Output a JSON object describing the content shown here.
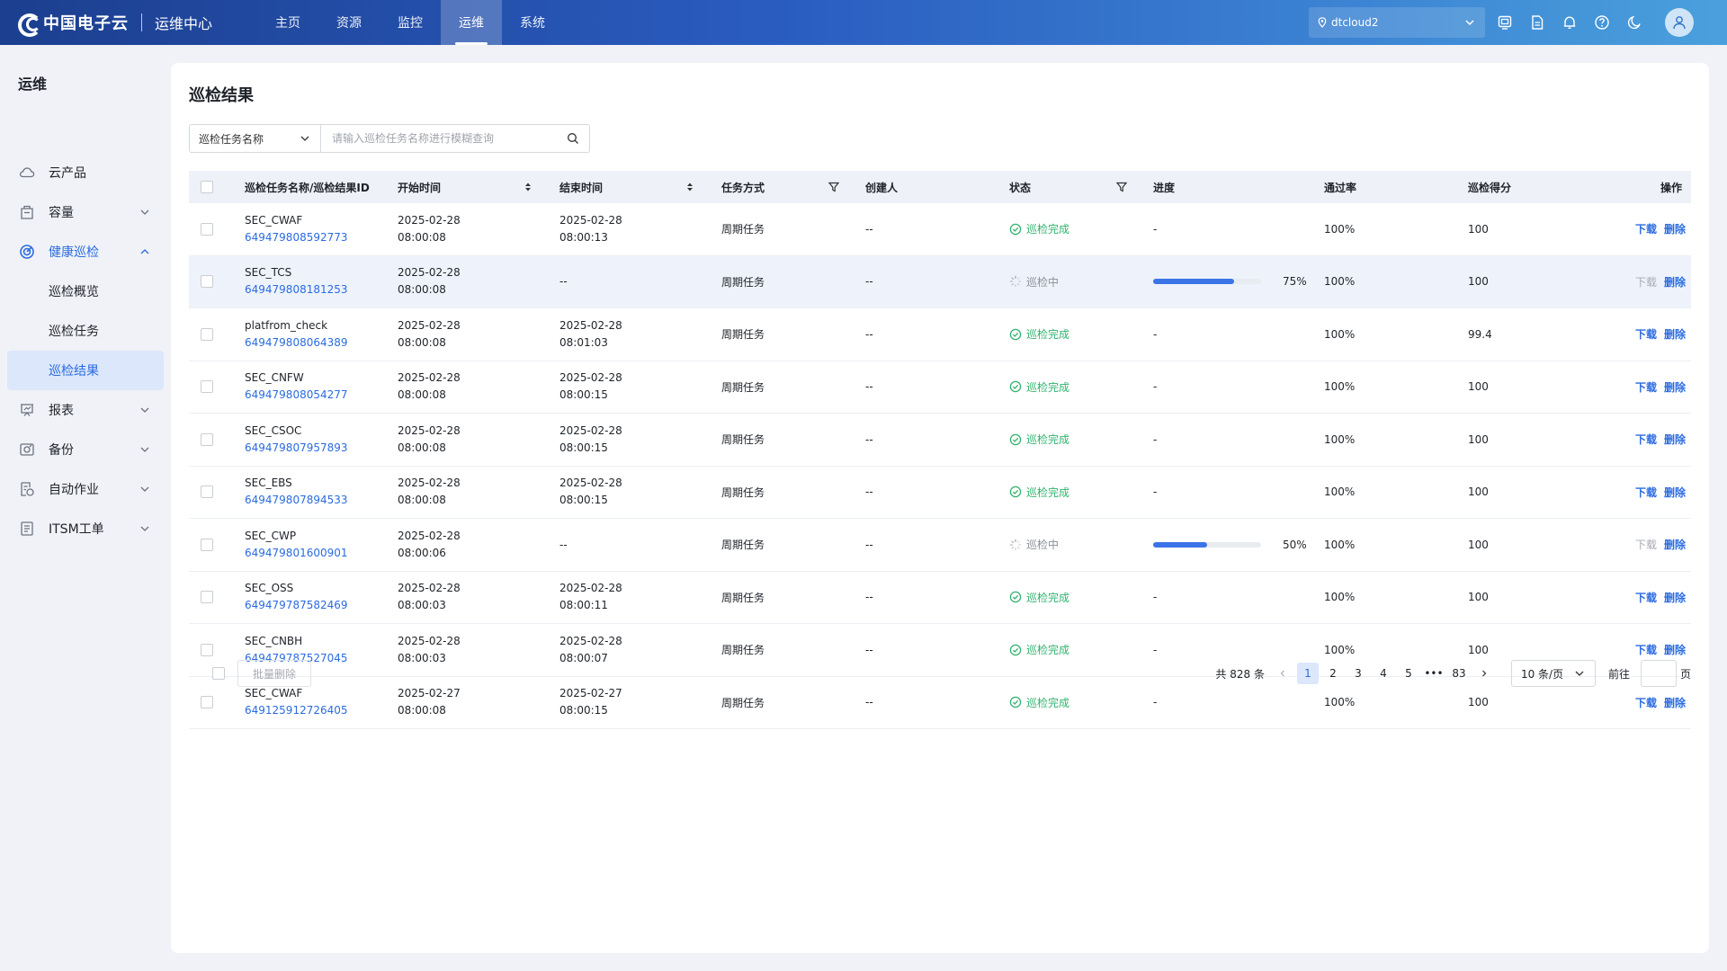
{
  "brand": {
    "logo_text": "中国电子云",
    "subtitle": "运维中心"
  },
  "topnav": [
    {
      "label": "主页",
      "active": false
    },
    {
      "label": "资源",
      "active": false
    },
    {
      "label": "监控",
      "active": false
    },
    {
      "label": "运维",
      "active": true
    },
    {
      "label": "系统",
      "active": false
    }
  ],
  "region": {
    "value": "dtcloud2"
  },
  "top_icons": [
    "screen-icon",
    "document-icon",
    "bell-icon",
    "help-icon",
    "moon-icon"
  ],
  "sidebar": {
    "title": "运维",
    "items": [
      {
        "label": "云产品",
        "icon": "cloud-icon"
      },
      {
        "label": "容量",
        "icon": "capacity-icon"
      },
      {
        "label": "健康巡检",
        "icon": "health-icon",
        "open": true,
        "children": [
          {
            "label": "巡检概览"
          },
          {
            "label": "巡检任务"
          },
          {
            "label": "巡检结果",
            "active": true
          }
        ]
      },
      {
        "label": "报表",
        "icon": "report-icon"
      },
      {
        "label": "备份",
        "icon": "backup-icon"
      },
      {
        "label": "自动作业",
        "icon": "automation-icon"
      },
      {
        "label": "ITSM工单",
        "icon": "ticket-icon"
      }
    ]
  },
  "page": {
    "title": "巡检结果"
  },
  "search": {
    "field": "巡检任务名称",
    "placeholder": "请输入巡检任务名称进行模糊查询"
  },
  "table": {
    "headers": {
      "name": "巡检任务名称/巡检结果ID",
      "start": "开始时间",
      "end": "结束时间",
      "mode": "任务方式",
      "creator": "创建人",
      "status": "状态",
      "progress": "进度",
      "rate": "通过率",
      "score": "巡检得分",
      "ops": "操作"
    },
    "rows": [
      {
        "name": "SEC_CWAF",
        "id": "649479808592773",
        "start_date": "2025-02-28",
        "start_time": "08:00:08",
        "end_date": "2025-02-28",
        "end_time": "08:00:13",
        "mode": "周期任务",
        "creator": "--",
        "status": "巡检完成",
        "status_type": "done",
        "progress": "-",
        "progress_pct": null,
        "rate": "100%",
        "score": "100",
        "download": "下载",
        "download_enabled": true,
        "delete": "删除"
      },
      {
        "name": "SEC_TCS",
        "id": "649479808181253",
        "start_date": "2025-02-28",
        "start_time": "08:00:08",
        "end_date": "--",
        "end_time": "",
        "mode": "周期任务",
        "creator": "--",
        "status": "巡检中",
        "status_type": "running",
        "progress": "75%",
        "progress_pct": 75,
        "rate": "100%",
        "score": "100",
        "download": "下载",
        "download_enabled": false,
        "delete": "删除"
      },
      {
        "name": "platfrom_check",
        "id": "649479808064389",
        "start_date": "2025-02-28",
        "start_time": "08:00:08",
        "end_date": "2025-02-28",
        "end_time": "08:01:03",
        "mode": "周期任务",
        "creator": "--",
        "status": "巡检完成",
        "status_type": "done",
        "progress": "-",
        "progress_pct": null,
        "rate": "100%",
        "score": "99.4",
        "download": "下载",
        "download_enabled": true,
        "delete": "删除"
      },
      {
        "name": "SEC_CNFW",
        "id": "649479808054277",
        "start_date": "2025-02-28",
        "start_time": "08:00:08",
        "end_date": "2025-02-28",
        "end_time": "08:00:15",
        "mode": "周期任务",
        "creator": "--",
        "status": "巡检完成",
        "status_type": "done",
        "progress": "-",
        "progress_pct": null,
        "rate": "100%",
        "score": "100",
        "download": "下载",
        "download_enabled": true,
        "delete": "删除"
      },
      {
        "name": "SEC_CSOC",
        "id": "649479807957893",
        "start_date": "2025-02-28",
        "start_time": "08:00:08",
        "end_date": "2025-02-28",
        "end_time": "08:00:15",
        "mode": "周期任务",
        "creator": "--",
        "status": "巡检完成",
        "status_type": "done",
        "progress": "-",
        "progress_pct": null,
        "rate": "100%",
        "score": "100",
        "download": "下载",
        "download_enabled": true,
        "delete": "删除"
      },
      {
        "name": "SEC_EBS",
        "id": "649479807894533",
        "start_date": "2025-02-28",
        "start_time": "08:00:08",
        "end_date": "2025-02-28",
        "end_time": "08:00:15",
        "mode": "周期任务",
        "creator": "--",
        "status": "巡检完成",
        "status_type": "done",
        "progress": "-",
        "progress_pct": null,
        "rate": "100%",
        "score": "100",
        "download": "下载",
        "download_enabled": true,
        "delete": "删除"
      },
      {
        "name": "SEC_CWP",
        "id": "649479801600901",
        "start_date": "2025-02-28",
        "start_time": "08:00:06",
        "end_date": "--",
        "end_time": "",
        "mode": "周期任务",
        "creator": "--",
        "status": "巡检中",
        "status_type": "running",
        "progress": "50%",
        "progress_pct": 50,
        "rate": "100%",
        "score": "100",
        "download": "下载",
        "download_enabled": false,
        "delete": "删除"
      },
      {
        "name": "SEC_OSS",
        "id": "649479787582469",
        "start_date": "2025-02-28",
        "start_time": "08:00:03",
        "end_date": "2025-02-28",
        "end_time": "08:00:11",
        "mode": "周期任务",
        "creator": "--",
        "status": "巡检完成",
        "status_type": "done",
        "progress": "-",
        "progress_pct": null,
        "rate": "100%",
        "score": "100",
        "download": "下载",
        "download_enabled": true,
        "delete": "删除"
      },
      {
        "name": "SEC_CNBH",
        "id": "649479787527045",
        "start_date": "2025-02-28",
        "start_time": "08:00:03",
        "end_date": "2025-02-28",
        "end_time": "08:00:07",
        "mode": "周期任务",
        "creator": "--",
        "status": "巡检完成",
        "status_type": "done",
        "progress": "-",
        "progress_pct": null,
        "rate": "100%",
        "score": "100",
        "download": "下载",
        "download_enabled": true,
        "delete": "删除"
      },
      {
        "name": "SEC_CWAF",
        "id": "649125912726405",
        "start_date": "2025-02-27",
        "start_time": "08:00:08",
        "end_date": "2025-02-27",
        "end_time": "08:00:15",
        "mode": "周期任务",
        "creator": "--",
        "status": "巡检完成",
        "status_type": "done",
        "progress": "-",
        "progress_pct": null,
        "rate": "100%",
        "score": "100",
        "download": "下载",
        "download_enabled": true,
        "delete": "删除"
      }
    ]
  },
  "footer": {
    "bulk_delete": "批量删除",
    "total": "共 828 条",
    "pages": [
      "1",
      "2",
      "3",
      "4",
      "5",
      "•••",
      "83"
    ],
    "current_page": "1",
    "page_size": "10 条/页",
    "goto_label": "前往",
    "goto_suffix": "页"
  },
  "colors": {
    "accent": "#2a6be0",
    "success": "#2fb36e",
    "progress": "#3b74e6"
  }
}
